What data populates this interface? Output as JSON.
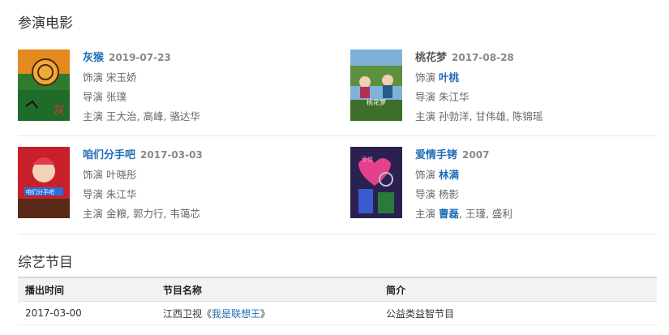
{
  "sections": {
    "movies_title": "参演电影",
    "variety_title": "综艺节目"
  },
  "movies": [
    {
      "title": "灰猴",
      "date": "2019-07-23",
      "role_label": "饰演",
      "role": "宋玉娇",
      "director_label": "导演",
      "director": "张璞",
      "cast_label": "主演",
      "cast": "王大治, 高峰, 骆达华",
      "poster_icon": "poster-hui-hou"
    },
    {
      "title": "桃花梦",
      "date": "2017-08-28",
      "role_label": "饰演",
      "role": "叶桃",
      "director_label": "导演",
      "director": "朱江华",
      "cast_label": "主演",
      "cast": "孙勃洋, 甘伟雄, 陈锦瑶",
      "poster_icon": "poster-tao-hua-meng"
    },
    {
      "title": "咱们分手吧",
      "date": "2017-03-03",
      "role_label": "饰演",
      "role": "叶晓彤",
      "director_label": "导演",
      "director": "朱江华",
      "cast_label": "主演",
      "cast": "金粮, 郭力行, 韦蔼芯",
      "poster_icon": "poster-zan-men-fen-shou-ba"
    },
    {
      "title": "爱情手铐",
      "date": "2007",
      "role_label": "饰演",
      "role": "林满",
      "director_label": "导演",
      "director": "杨影",
      "cast_label": "主演",
      "cast_first": "曹磊",
      "cast_rest": ", 王瑾, 盛利",
      "poster_icon": "poster-ai-qing-shou-kao"
    }
  ],
  "variety": {
    "headers": [
      "播出时间",
      "节目名称",
      "简介"
    ],
    "rows": [
      {
        "date": "2017-03-00",
        "channel_prefix": "江西卫视《",
        "show": "我是联想王",
        "channel_suffix": "》",
        "intro": "公益类益智节目"
      }
    ]
  },
  "colors": {
    "link": "#1f6db8",
    "date": "#888888",
    "label": "#666666",
    "table_header_bg": "#f2f2f2"
  }
}
